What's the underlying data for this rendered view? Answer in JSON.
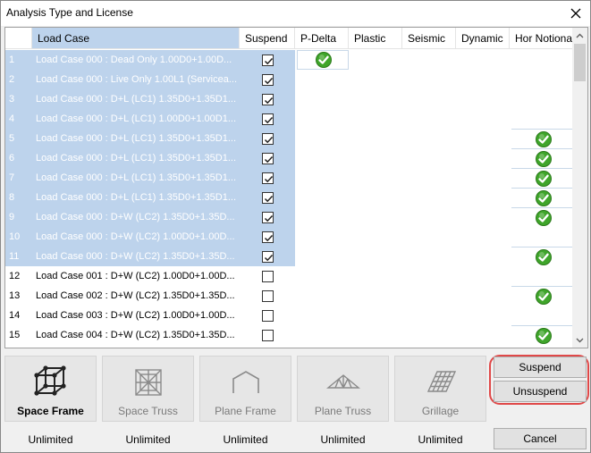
{
  "window": {
    "title": "Analysis Type and License"
  },
  "grid": {
    "columns": [
      "",
      "Load Case",
      "Suspend",
      "P-Delta",
      "Plastic",
      "Seismic",
      "Dynamic",
      "Hor Notional"
    ],
    "rows": [
      {
        "num": "1",
        "load_case": "Load Case 000 : Dead Only 1.00D0+1.00D...",
        "suspend": true,
        "selected": true,
        "p_delta": true,
        "hor_notional": false
      },
      {
        "num": "2",
        "load_case": "Load Case 000 : Live Only 1.00L1 (Servicea...",
        "suspend": true,
        "selected": true,
        "p_delta": false,
        "hor_notional": false
      },
      {
        "num": "3",
        "load_case": "Load Case 000 : D+L (LC1) 1.35D0+1.35D1...",
        "suspend": true,
        "selected": true,
        "p_delta": false,
        "hor_notional": false
      },
      {
        "num": "4",
        "load_case": "Load Case 000 : D+L (LC1) 1.00D0+1.00D1...",
        "suspend": true,
        "selected": true,
        "p_delta": false,
        "hor_notional": false
      },
      {
        "num": "5",
        "load_case": "Load Case 000 : D+L (LC1) 1.35D0+1.35D1...",
        "suspend": true,
        "selected": true,
        "p_delta": false,
        "hor_notional": true
      },
      {
        "num": "6",
        "load_case": "Load Case 000 : D+L (LC1) 1.35D0+1.35D1...",
        "suspend": true,
        "selected": true,
        "p_delta": false,
        "hor_notional": true
      },
      {
        "num": "7",
        "load_case": "Load Case 000 : D+L (LC1) 1.35D0+1.35D1...",
        "suspend": true,
        "selected": true,
        "p_delta": false,
        "hor_notional": true
      },
      {
        "num": "8",
        "load_case": "Load Case 000 : D+L (LC1) 1.35D0+1.35D1...",
        "suspend": true,
        "selected": true,
        "p_delta": false,
        "hor_notional": true
      },
      {
        "num": "9",
        "load_case": "Load Case 000 : D+W (LC2) 1.35D0+1.35D...",
        "suspend": true,
        "selected": true,
        "p_delta": false,
        "hor_notional": true
      },
      {
        "num": "10",
        "load_case": "Load Case 000 : D+W (LC2) 1.00D0+1.00D...",
        "suspend": true,
        "selected": true,
        "p_delta": false,
        "hor_notional": false
      },
      {
        "num": "11",
        "load_case": "Load Case 000 : D+W (LC2) 1.35D0+1.35D...",
        "suspend": true,
        "selected": true,
        "p_delta": false,
        "hor_notional": true
      },
      {
        "num": "12",
        "load_case": "Load Case 001 : D+W (LC2) 1.00D0+1.00D...",
        "suspend": false,
        "selected": false,
        "p_delta": false,
        "hor_notional": false
      },
      {
        "num": "13",
        "load_case": "Load Case 002 : D+W (LC2) 1.35D0+1.35D...",
        "suspend": false,
        "selected": false,
        "p_delta": false,
        "hor_notional": true
      },
      {
        "num": "14",
        "load_case": "Load Case 003 : D+W (LC2) 1.00D0+1.00D...",
        "suspend": false,
        "selected": false,
        "p_delta": false,
        "hor_notional": false
      },
      {
        "num": "15",
        "load_case": "Load Case 004 : D+W (LC2) 1.35D0+1.35D...",
        "suspend": false,
        "selected": false,
        "p_delta": false,
        "hor_notional": true
      }
    ]
  },
  "analysis_types": [
    {
      "label": "Space Frame",
      "license": "Unlimited",
      "icon": "space-frame-icon",
      "active": true
    },
    {
      "label": "Space Truss",
      "license": "Unlimited",
      "icon": "space-truss-icon",
      "active": false
    },
    {
      "label": "Plane Frame",
      "license": "Unlimited",
      "icon": "plane-frame-icon",
      "active": false
    },
    {
      "label": "Plane Truss",
      "license": "Unlimited",
      "icon": "plane-truss-icon",
      "active": false
    },
    {
      "label": "Grillage",
      "license": "Unlimited",
      "icon": "grillage-icon",
      "active": false
    }
  ],
  "buttons": {
    "suspend": "Suspend",
    "unsuspend": "Unsuspend",
    "cancel": "Cancel"
  },
  "colors": {
    "selection": "#bdd3ec",
    "highlight": "#e04848",
    "check_green": "#3fa52a"
  }
}
